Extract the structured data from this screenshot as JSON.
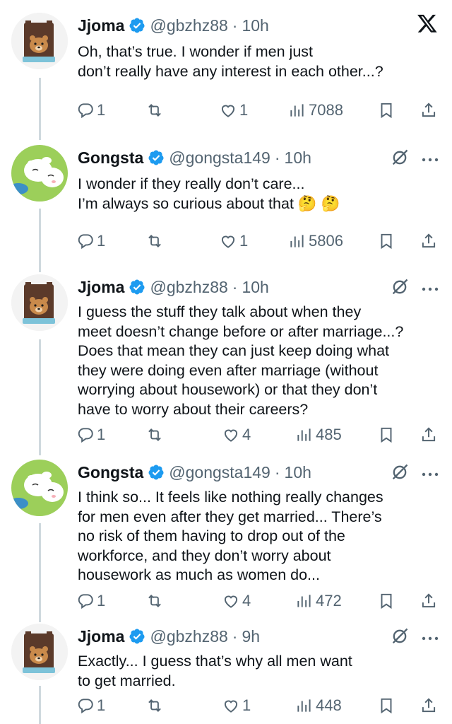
{
  "header": {
    "logo_icon": "x-logo-icon"
  },
  "colors": {
    "text": "#0f1419",
    "muted": "#536471",
    "verified": "#1d9bf0",
    "thread_line": "#cfd9de"
  },
  "tweets": [
    {
      "author": "Jjoma",
      "handle": "@gbzhz88",
      "separator": "·",
      "time": "10h",
      "text": "Oh, that’s true. I wonder if men just\ndon’t really have any interest in each other...?",
      "replies": "1",
      "reposts": "",
      "likes": "1",
      "views": "7088"
    },
    {
      "author": "Gongsta",
      "handle": "@gongsta149",
      "separator": "·",
      "time": "10h",
      "text": "I wonder if they really don’t care...\nI’m always so curious about that 🤔 🤔",
      "replies": "1",
      "reposts": "",
      "likes": "1",
      "views": "5806"
    },
    {
      "author": "Jjoma",
      "handle": "@gbzhz88",
      "separator": "·",
      "time": "10h",
      "text": "I guess the stuff they talk about when they\nmeet doesn’t change before or after marriage...?\nDoes that mean they can just keep doing what\nthey were doing even after marriage (without\nworrying about housework) or that they don’t\nhave to worry about their careers?",
      "replies": "1",
      "reposts": "",
      "likes": "4",
      "views": "485"
    },
    {
      "author": "Gongsta",
      "handle": "@gongsta149",
      "separator": "·",
      "time": "10h",
      "text": "I think so... It feels like nothing really changes\nfor men even after they get married... There’s\nno risk of them having to drop out of the\nworkforce, and they don’t worry about\nhousework as much as women do...",
      "replies": "1",
      "reposts": "",
      "likes": "4",
      "views": "472"
    },
    {
      "author": "Jjoma",
      "handle": "@gbzhz88",
      "separator": "·",
      "time": "9h",
      "text": "Exactly... I guess that’s why all men want\nto get married.",
      "replies": "1",
      "reposts": "",
      "likes": "1",
      "views": "448"
    }
  ]
}
